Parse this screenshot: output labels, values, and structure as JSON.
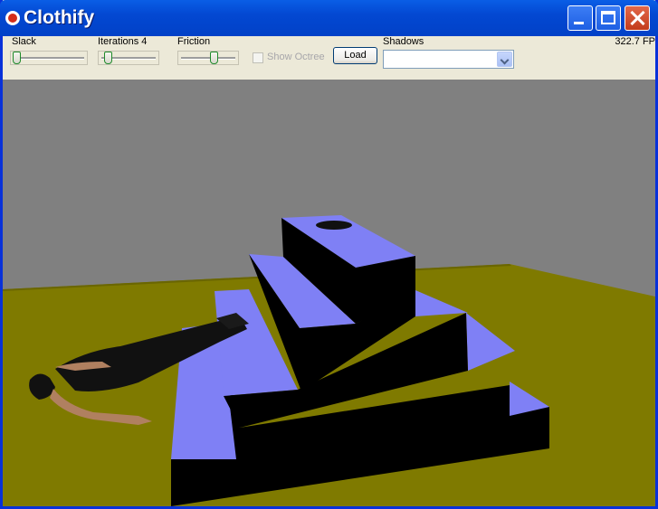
{
  "window": {
    "title": "Clothify",
    "minimize_icon": "minimize-icon",
    "maximize_icon": "maximize-icon",
    "close_icon": "close-icon"
  },
  "toolbar": {
    "slack": {
      "label": "Slack",
      "value_fraction": 0.05
    },
    "iterations": {
      "label": "Iterations 4",
      "value_fraction": 0.1
    },
    "friction": {
      "label": "Friction",
      "value_fraction": 0.55
    },
    "show_octree": {
      "label": "Show Octree",
      "checked": false,
      "enabled": false
    },
    "load_label": "Load",
    "shadows": {
      "label": "Shadows",
      "selected": ""
    },
    "fps": "322.7 FP"
  },
  "scene": {
    "colors": {
      "wall": "#808080",
      "floor": "#7f7a00",
      "step_top": "#7f80f5",
      "step_side": "#000000",
      "skin": "#b08060",
      "clothing": "#111111"
    }
  }
}
